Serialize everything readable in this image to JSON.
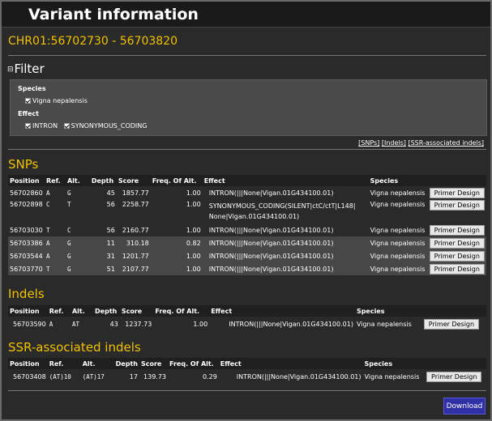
{
  "app_title": "Variant information",
  "region": "CHR01:56702730 - 56703820",
  "filter": {
    "toggle": "⊟",
    "title": "Filter",
    "species_label": "Species",
    "species_options": [
      "Vigna nepalensis"
    ],
    "effect_label": "Effect",
    "effect_options": [
      "INTRON",
      "SYNONYMOUS_CODING"
    ]
  },
  "links": [
    "[SNPs]",
    "[Indels]",
    "[SSR-associated indels]"
  ],
  "snps": {
    "title": "SNPs",
    "headers": [
      "Position",
      "Ref.",
      "Alt.",
      "Depth",
      "Score",
      "Freq. Of Alt.",
      "Effect",
      "Species",
      ""
    ],
    "rows": [
      {
        "position": "56702860",
        "ref": "A",
        "alt": "G",
        "depth": "45",
        "score": "1857.77",
        "freq": "1.00",
        "effect": "INTRON(|||None|Vigan.01G434100.01)",
        "species": "Vigna nepalensis",
        "button": "Primer Design"
      },
      {
        "position": "56702898",
        "ref": "C",
        "alt": "T",
        "depth": "56",
        "score": "2258.77",
        "freq": "1.00",
        "effect_line1": "SYNONYMOUS_CODING(SILENT|ctC/ctT|L148|",
        "effect_line2": "None|Vigan.01G434100.01)",
        "species": "Vigna nepalensis",
        "button": "Primer Design"
      },
      {
        "position": "56703030",
        "ref": "T",
        "alt": "C",
        "depth": "56",
        "score": "2160.77",
        "freq": "1.00",
        "effect": "INTRON(|||None|Vigan.01G434100.01)",
        "species": "Vigna nepalensis",
        "button": "Primer Design"
      },
      {
        "position": "56703386",
        "ref": "A",
        "alt": "G",
        "depth": "11",
        "score": "310.18",
        "freq": "0.82",
        "effect": "INTRON(|||None|Vigan.01G434100.01)",
        "species": "Vigna nepalensis",
        "button": "Primer Design"
      },
      {
        "position": "56703544",
        "ref": "A",
        "alt": "G",
        "depth": "31",
        "score": "1201.77",
        "freq": "1.00",
        "effect": "INTRON(|||None|Vigan.01G434100.01)",
        "species": "Vigna nepalensis",
        "button": "Primer Design"
      },
      {
        "position": "56703770",
        "ref": "T",
        "alt": "G",
        "depth": "51",
        "score": "2107.77",
        "freq": "1.00",
        "effect": "INTRON(|||None|Vigan.01G434100.01)",
        "species": "Vigna nepalensis",
        "button": "Primer Design"
      }
    ]
  },
  "indels": {
    "title": "Indels",
    "headers": [
      "Position",
      "Ref.",
      "Alt.",
      "Depth",
      "Score",
      "Freq. Of Alt.",
      "Effect",
      "Species",
      ""
    ],
    "rows": [
      {
        "position": "56703590",
        "ref": "A",
        "alt": "AT",
        "depth": "43",
        "score": "1237.73",
        "freq": "1.00",
        "effect": "INTRON(|||None|Vigan.01G434100.01)",
        "species": "Vigna nepalensis",
        "button": "Primer Design"
      }
    ]
  },
  "ssr": {
    "title": "SSR-associated indels",
    "headers": [
      "Position",
      "Ref.",
      "Alt.",
      "Depth",
      "Score",
      "Freq. Of Alt.",
      "Effect",
      "Species",
      ""
    ],
    "rows": [
      {
        "position": "56703408",
        "ref": "(AT)10",
        "alt": "(AT)17",
        "depth": "17",
        "score": "139.73",
        "freq": "0.29",
        "effect": "INTRON(|||None|Vigan.01G434100.01)",
        "species": "Vigna nepalensis",
        "button": "Primer Design"
      }
    ]
  },
  "download_label": "Download",
  "colors": {
    "accent": "#f2c200",
    "download": "#2f2fa8"
  }
}
